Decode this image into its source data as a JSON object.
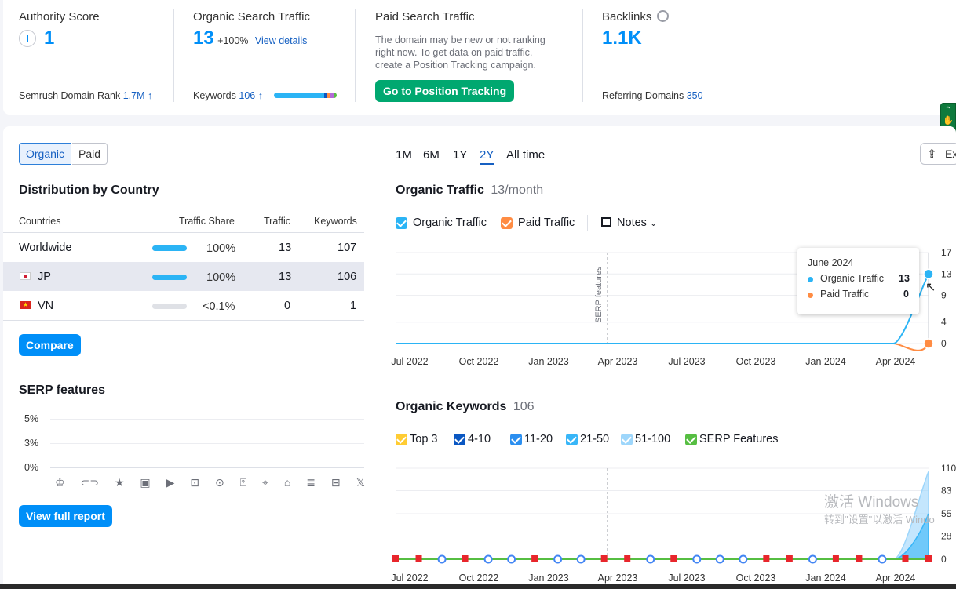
{
  "summary": {
    "authority": {
      "label": "Authority Score",
      "value": "1",
      "rank_label": "Semrush Domain Rank",
      "rank_value": "1.7M"
    },
    "organic": {
      "label": "Organic Search Traffic",
      "value": "13",
      "change": "+100%",
      "details_link": "View details",
      "keywords_label": "Keywords",
      "keywords_value": "106"
    },
    "paid": {
      "label": "Paid Search Traffic",
      "text": [
        "The domain may be new or not ranking",
        "right now. To get data on paid traffic,",
        "create a Position Tracking campaign."
      ],
      "button": "Go to Position Tracking"
    },
    "backlinks": {
      "label": "Backlinks",
      "value": "1.1K",
      "ref_label": "Referring Domains",
      "ref_value": "350"
    }
  },
  "toggle": {
    "organic": "Organic",
    "paid": "Paid"
  },
  "distribution": {
    "title": "Distribution by Country",
    "headers": [
      "Countries",
      "Traffic Share",
      "Traffic",
      "Keywords"
    ],
    "rows": [
      {
        "country": "Worldwide",
        "share": "100%",
        "share_fraction": 1.0,
        "traffic": "13",
        "keywords": "107"
      },
      {
        "country": "JP",
        "share": "100%",
        "share_fraction": 1.0,
        "traffic": "13",
        "keywords": "106"
      },
      {
        "country": "VN",
        "share": "<0.1%",
        "share_fraction": 0.0,
        "traffic": "0",
        "keywords": "1"
      }
    ],
    "compare_button": "Compare"
  },
  "serp": {
    "title": "SERP features",
    "yticks": [
      "5%",
      "3%",
      "0%"
    ],
    "full_report_button": "View full report"
  },
  "periods": [
    "1M",
    "6M",
    "1Y",
    "2Y",
    "All time"
  ],
  "active_period": "2Y",
  "export_label": "Ex",
  "traffic_chart": {
    "title": "Organic Traffic",
    "subtitle": "13/month",
    "legend": [
      "Organic Traffic",
      "Paid Traffic"
    ],
    "notes_label": "Notes",
    "annotation": "SERP features",
    "yticks": [
      "17",
      "13",
      "9",
      "4",
      "0"
    ],
    "xticks": [
      "Jul 2022",
      "Oct 2022",
      "Jan 2023",
      "Apr 2023",
      "Jul 2023",
      "Oct 2023",
      "Jan 2024",
      "Apr 2024"
    ],
    "tooltip": {
      "date": "June 2024",
      "organic_label": "Organic Traffic",
      "organic_value": "13",
      "paid_label": "Paid Traffic",
      "paid_value": "0"
    },
    "colors": {
      "organic": "#2bb4f5",
      "paid": "#ff8c43"
    }
  },
  "keywords_chart": {
    "title": "Organic Keywords",
    "subtitle": "106",
    "legend": [
      "Top 3",
      "4-10",
      "11-20",
      "21-50",
      "51-100",
      "SERP Features"
    ],
    "legend_colors": [
      "#ffcc33",
      "#0a57c2",
      "#2b8ff0",
      "#38b6f8",
      "#9dd6fb",
      "#56be42"
    ],
    "yticks": [
      "110",
      "83",
      "55",
      "28",
      "0"
    ],
    "xticks": [
      "Jul 2022",
      "Oct 2022",
      "Jan 2023",
      "Apr 2023",
      "Jul 2023",
      "Oct 2023",
      "Jan 2024",
      "Apr 2024"
    ]
  },
  "watermark": {
    "line1": "激活 Windows",
    "line2": "转到\"设置\"以激活 Windo"
  },
  "chart_data": [
    {
      "type": "line",
      "title": "Organic Traffic",
      "x": [
        "Jul 2022",
        "Oct 2022",
        "Jan 2023",
        "Apr 2023",
        "Jul 2023",
        "Oct 2023",
        "Jan 2024",
        "Apr 2024",
        "Jun 2024"
      ],
      "series": [
        {
          "name": "Organic Traffic",
          "values": [
            0,
            0,
            0,
            0,
            0,
            0,
            0,
            0,
            13
          ]
        },
        {
          "name": "Paid Traffic",
          "values": [
            0,
            0,
            0,
            0,
            0,
            0,
            0,
            0,
            0
          ]
        }
      ],
      "ylim": [
        0,
        17
      ]
    },
    {
      "type": "area",
      "title": "Organic Keywords",
      "x": [
        "Jul 2022",
        "Oct 2022",
        "Jan 2023",
        "Apr 2023",
        "Jul 2023",
        "Oct 2023",
        "Jan 2024",
        "Apr 2024",
        "Jun 2024"
      ],
      "series": [
        {
          "name": "Top 3",
          "values": [
            0,
            0,
            0,
            0,
            0,
            0,
            0,
            0,
            0
          ]
        },
        {
          "name": "4-10",
          "values": [
            0,
            0,
            0,
            0,
            0,
            0,
            0,
            0,
            0
          ]
        },
        {
          "name": "11-20",
          "values": [
            0,
            0,
            0,
            0,
            0,
            0,
            0,
            0,
            0
          ]
        },
        {
          "name": "21-50",
          "values": [
            0,
            0,
            0,
            0,
            0,
            0,
            0,
            0,
            55
          ]
        },
        {
          "name": "51-100",
          "values": [
            0,
            0,
            0,
            0,
            0,
            0,
            0,
            0,
            106
          ]
        }
      ],
      "ylim": [
        0,
        110
      ]
    }
  ]
}
